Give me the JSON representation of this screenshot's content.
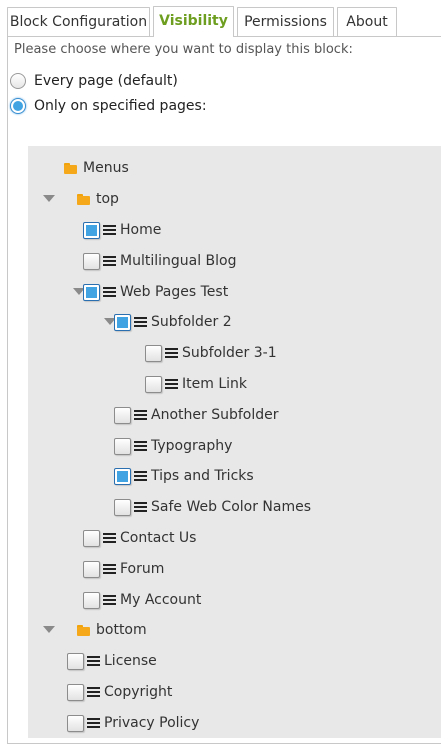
{
  "tabs": [
    {
      "label": "Block Configuration",
      "active": false
    },
    {
      "label": "Visibility",
      "active": true
    },
    {
      "label": "Permissions",
      "active": false
    },
    {
      "label": "About",
      "active": false
    }
  ],
  "visibility": {
    "prompt": "Please choose where you want to display this block:",
    "options": [
      {
        "label": "Every page (default)",
        "selected": false
      },
      {
        "label": "Only on specified pages:",
        "selected": true
      }
    ]
  },
  "tree": {
    "root_label": "Menus",
    "items": [
      {
        "label": "top",
        "type": "folder",
        "expanded": true
      },
      {
        "label": "Home",
        "type": "page",
        "checked": true
      },
      {
        "label": "Multilingual Blog",
        "type": "page",
        "checked": false
      },
      {
        "label": "Web Pages Test",
        "type": "page",
        "checked": true,
        "expanded": true
      },
      {
        "label": "Subfolder 2",
        "type": "page",
        "checked": true,
        "expanded": true
      },
      {
        "label": "Subfolder 3-1",
        "type": "page",
        "checked": false
      },
      {
        "label": "Item Link",
        "type": "page",
        "checked": false
      },
      {
        "label": "Another Subfolder",
        "type": "page",
        "checked": false
      },
      {
        "label": "Typography",
        "type": "page",
        "checked": false
      },
      {
        "label": "Tips and Tricks",
        "type": "page",
        "checked": true
      },
      {
        "label": "Safe Web Color Names",
        "type": "page",
        "checked": false
      },
      {
        "label": "Contact Us",
        "type": "page",
        "checked": false
      },
      {
        "label": "Forum",
        "type": "page",
        "checked": false
      },
      {
        "label": "My Account",
        "type": "page",
        "checked": false
      },
      {
        "label": "bottom",
        "type": "folder",
        "expanded": true
      },
      {
        "label": "License",
        "type": "page",
        "checked": false
      },
      {
        "label": "Copyright",
        "type": "page",
        "checked": false
      },
      {
        "label": "Privacy Policy",
        "type": "page",
        "checked": false
      }
    ]
  },
  "colors": {
    "active_tab": "#6e9e1f",
    "checkbox_fill": "#41a3e2",
    "folder": "#f5a81a",
    "tree_bg": "#e8e8e8"
  }
}
